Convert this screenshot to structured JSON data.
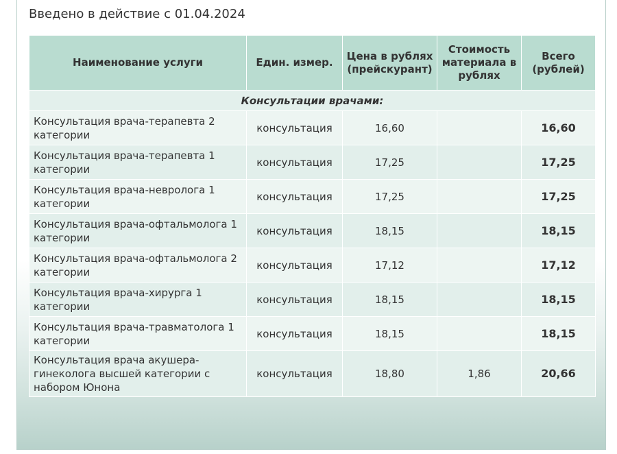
{
  "effective_note": "Введено в действие с 01.04.2024",
  "table": {
    "headers": {
      "name": "Наименование услуги",
      "unit": "Един. измер.",
      "price": "Цена в рублях (прейскурант)",
      "material": "Стоимость материала в рублях",
      "total": "Всего (рублей)"
    },
    "section_title": "Консультации врачами:",
    "rows": [
      {
        "name": "Консультация врача-терапевта 2 категории",
        "unit": "консультация",
        "price": "16,60",
        "material": "",
        "total": "16,60"
      },
      {
        "name": "Консультация врача-терапевта 1 категории",
        "unit": "консультация",
        "price": "17,25",
        "material": "",
        "total": "17,25"
      },
      {
        "name": "Консультация врача-невролога 1 категории",
        "unit": "консультация",
        "price": "17,25",
        "material": "",
        "total": "17,25"
      },
      {
        "name": "Консультация врача-офтальмолога 1 категории",
        "unit": "консультация",
        "price": "18,15",
        "material": "",
        "total": "18,15"
      },
      {
        "name": "Консультация врача-офтальмолога 2 категории",
        "unit": "консультация",
        "price": "17,12",
        "material": "",
        "total": "17,12"
      },
      {
        "name": "Консультация врача-хирурга 1 категории",
        "unit": "консультация",
        "price": "18,15",
        "material": "",
        "total": "18,15"
      },
      {
        "name": "Консультация врача-травматолога 1 категории",
        "unit": "консультация",
        "price": "18,15",
        "material": "",
        "total": "18,15"
      },
      {
        "name": "Консультация врача акушера-гинеколога высшей категории с набором Юнона",
        "unit": "консультация",
        "price": "18,80",
        "material": "1,86",
        "total": "20,66"
      }
    ]
  }
}
